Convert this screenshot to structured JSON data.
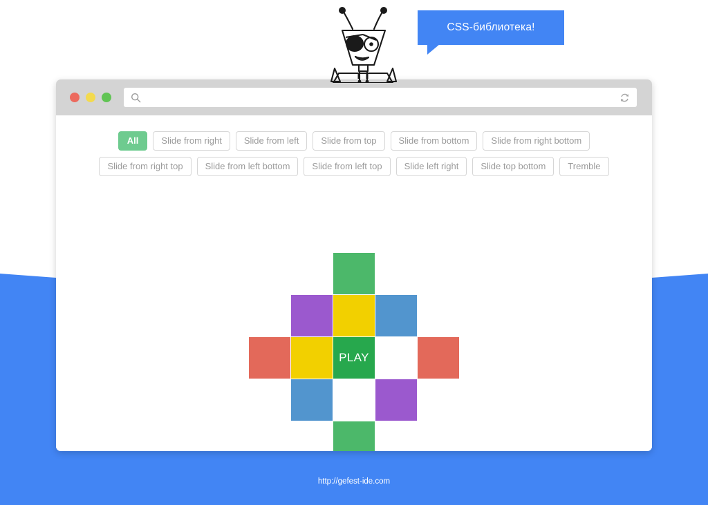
{
  "background": {
    "blue": "#4285f4",
    "white": "#ffffff"
  },
  "mascot": {
    "icon": "robot-pirate-mascot",
    "description": "line-art robot with eye patch and antennae"
  },
  "speech_bubble": {
    "text": "CSS-библиотека!",
    "color": "#4285f4",
    "text_color": "#ffffff"
  },
  "browser": {
    "traffic_lights": [
      {
        "name": "close",
        "color": "#ec6a5e"
      },
      {
        "name": "minimize",
        "color": "#f3da4e"
      },
      {
        "name": "maximize",
        "color": "#61c454"
      }
    ],
    "address_bar": {
      "value": "",
      "placeholder": "",
      "search_icon": "search-icon",
      "reload_icon": "refresh-icon"
    }
  },
  "filters": {
    "items": [
      {
        "label": "All",
        "active": true
      },
      {
        "label": "Slide from right",
        "active": false
      },
      {
        "label": "Slide from left",
        "active": false
      },
      {
        "label": "Slide from top",
        "active": false
      },
      {
        "label": "Slide from bottom",
        "active": false
      },
      {
        "label": "Slide from right bottom",
        "active": false
      },
      {
        "label": "Slide from right top",
        "active": false
      },
      {
        "label": "Slide from left bottom",
        "active": false
      },
      {
        "label": "Slide from left top",
        "active": false
      },
      {
        "label": "Slide left right",
        "active": false
      },
      {
        "label": "Slide top bottom",
        "active": false
      },
      {
        "label": "Tremble",
        "active": false
      }
    ],
    "active_color": "#6ecb8f",
    "inactive_text_color": "#9b9b9b"
  },
  "grid": {
    "columns": 5,
    "rows": 5,
    "cell_size": 60,
    "palette": {
      "green": "#4cb86a",
      "play_green": "#27a84d",
      "yellow": "#f2d000",
      "blue": "#5295ce",
      "purple": "#9b59ce",
      "red": "#e3695a",
      "white": "#ffffff",
      "empty": "transparent"
    },
    "center_label": "PLAY",
    "cells": [
      {
        "color": "empty",
        "label": ""
      },
      {
        "color": "empty",
        "label": ""
      },
      {
        "color": "green",
        "label": ""
      },
      {
        "color": "empty",
        "label": ""
      },
      {
        "color": "empty",
        "label": ""
      },
      {
        "color": "empty",
        "label": ""
      },
      {
        "color": "purple",
        "label": ""
      },
      {
        "color": "yellow",
        "label": ""
      },
      {
        "color": "blue",
        "label": ""
      },
      {
        "color": "empty",
        "label": ""
      },
      {
        "color": "red",
        "label": ""
      },
      {
        "color": "yellow",
        "label": ""
      },
      {
        "color": "play_green",
        "label": "PLAY"
      },
      {
        "color": "white",
        "label": ""
      },
      {
        "color": "red",
        "label": ""
      },
      {
        "color": "empty",
        "label": ""
      },
      {
        "color": "blue",
        "label": ""
      },
      {
        "color": "white",
        "label": ""
      },
      {
        "color": "purple",
        "label": ""
      },
      {
        "color": "empty",
        "label": ""
      },
      {
        "color": "empty",
        "label": ""
      },
      {
        "color": "empty",
        "label": ""
      },
      {
        "color": "green",
        "label": ""
      },
      {
        "color": "empty",
        "label": ""
      },
      {
        "color": "empty",
        "label": ""
      }
    ]
  },
  "footer": {
    "url": "http://gefest-ide.com"
  }
}
